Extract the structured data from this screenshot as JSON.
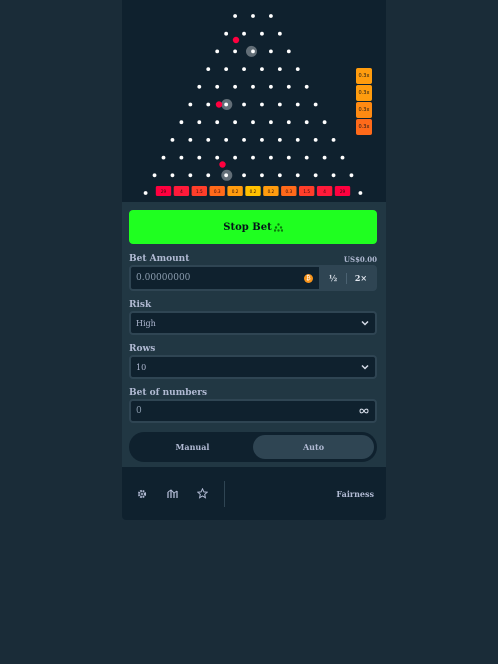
{
  "board": {
    "rows": 10,
    "multipliers": [
      "29",
      "4",
      "1.5",
      "0.3",
      "0.2",
      "0.2",
      "0.2",
      "0.3",
      "1.5",
      "4",
      "29"
    ],
    "multiplier_colors": [
      "#ff003f",
      "#ff1a3a",
      "#ff3e2a",
      "#ff6a1a",
      "#ff9c0e",
      "#ffc000",
      "#ff9c0e",
      "#ff6a1a",
      "#ff3e2a",
      "#ff1a3a",
      "#ff003f"
    ],
    "recent_results": [
      "0.3x",
      "0.3x",
      "0.3x",
      "0.3x"
    ],
    "recent_colors": [
      "#ff9c0e",
      "#ff9c0e",
      "#ff8a12",
      "#ff6a1a"
    ],
    "ball_color": "#ff003f",
    "peg_color": "#ffffff"
  },
  "controls": {
    "stop_label": "Stop Bet",
    "bet_amount_label": "Bet Amount",
    "bet_amount_usd": "US$0.00",
    "bet_amount_value": "0.00000000",
    "currency_icon": "bitcoin-icon",
    "half_label": "½",
    "double_label": "2×",
    "risk_label": "Risk",
    "risk_value": "High",
    "rows_label": "Rows",
    "rows_value": "10",
    "bets_label": "Bet of numbers",
    "bets_value": "0",
    "infinity_icon": "infinity-icon",
    "mode_manual": "Manual",
    "mode_auto": "Auto",
    "active_mode": "Auto"
  },
  "footer": {
    "icons": [
      "gear-icon",
      "chart-icon",
      "star-icon"
    ],
    "fairness_label": "Fairness"
  },
  "colors": {
    "accent_green": "#1fff20",
    "panel": "#213743",
    "dark": "#0f212e",
    "page": "#1a2c38"
  }
}
